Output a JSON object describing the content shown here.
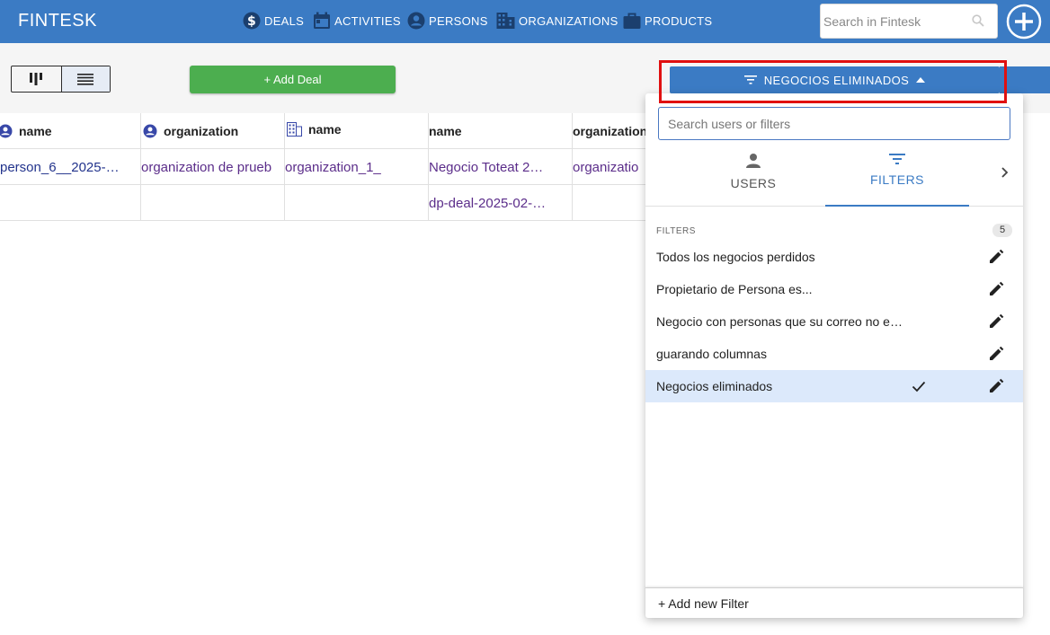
{
  "app": {
    "title": "FINTESK"
  },
  "nav": [
    {
      "label": "DEALS",
      "icon": "dollar-circle-icon"
    },
    {
      "label": "ACTIVITIES",
      "icon": "calendar-icon"
    },
    {
      "label": "PERSONS",
      "icon": "person-circle-icon"
    },
    {
      "label": "ORGANIZATIONS",
      "icon": "building-icon"
    },
    {
      "label": "PRODUCTS",
      "icon": "briefcase-icon"
    }
  ],
  "search": {
    "placeholder": "Search in Fintesk"
  },
  "toolbar": {
    "add_deal_label": "+ Add Deal",
    "filter_button_label": "NEGOCIOS ELIMINADOS"
  },
  "table": {
    "headers": [
      {
        "label": "name",
        "icon": "person-circle-icon"
      },
      {
        "label": "organization",
        "icon": "person-circle-icon"
      },
      {
        "label": "name",
        "icon": "building-icon"
      },
      {
        "label": "name",
        "icon": ""
      },
      {
        "label": "organization",
        "icon": ""
      }
    ],
    "rows": [
      [
        "person_6__2025-…",
        "organization de prueb",
        "organization_1_",
        "Negocio Toteat 2…",
        "organizatio"
      ],
      [
        "",
        "",
        "",
        "dp-deal-2025-02-…",
        ""
      ]
    ]
  },
  "dropdown": {
    "search_placeholder": "Search users or filters",
    "tabs": [
      {
        "label": "USERS",
        "icon": "person-icon"
      },
      {
        "label": "FILTERS",
        "icon": "filter-icon"
      }
    ],
    "section_title": "FILTERS",
    "count": "5",
    "filters": [
      {
        "label": "Todos los negocios perdidos",
        "selected": false
      },
      {
        "label": "Propietario de Persona es...",
        "selected": false
      },
      {
        "label": "Negocio con personas que su correo no e…",
        "selected": false
      },
      {
        "label": "guarando columnas",
        "selected": false
      },
      {
        "label": "Negocios eliminados",
        "selected": true
      }
    ],
    "footer_label": "+ Add new Filter"
  },
  "colors": {
    "primary": "#3b7bc4",
    "success": "#4cae4f",
    "highlight": "#e01010",
    "selected_row": "#dce9fb"
  }
}
